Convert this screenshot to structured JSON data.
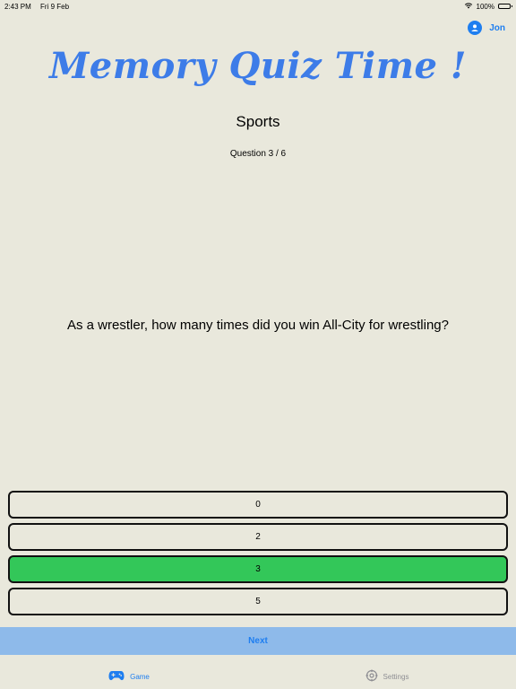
{
  "status_bar": {
    "time": "2:43 PM",
    "date": "Fri 9 Feb",
    "battery": "100%"
  },
  "profile": {
    "name": "Jon",
    "icon": "person-circle-icon"
  },
  "header": {
    "title": "Memory Quiz Time !",
    "category": "Sports",
    "question_counter": "Question 3 / 6"
  },
  "question": {
    "text": "As a wrestler, how many times did you win All-City for wrestling?"
  },
  "answers": [
    {
      "label": "0"
    },
    {
      "label": "2"
    },
    {
      "label": "3"
    },
    {
      "label": "5"
    }
  ],
  "next_button": {
    "label": "Next"
  },
  "tab_bar": {
    "tabs": [
      {
        "label": "Game",
        "icon": "gamecontroller-icon"
      },
      {
        "label": "Settings",
        "icon": "gear-icon"
      }
    ]
  },
  "colors": {
    "background": "#e9e8dc",
    "accent": "#1e7ef0",
    "title": "#3d7ce8",
    "selected_answer": "#33c759",
    "next_bar": "#8ebaea"
  }
}
